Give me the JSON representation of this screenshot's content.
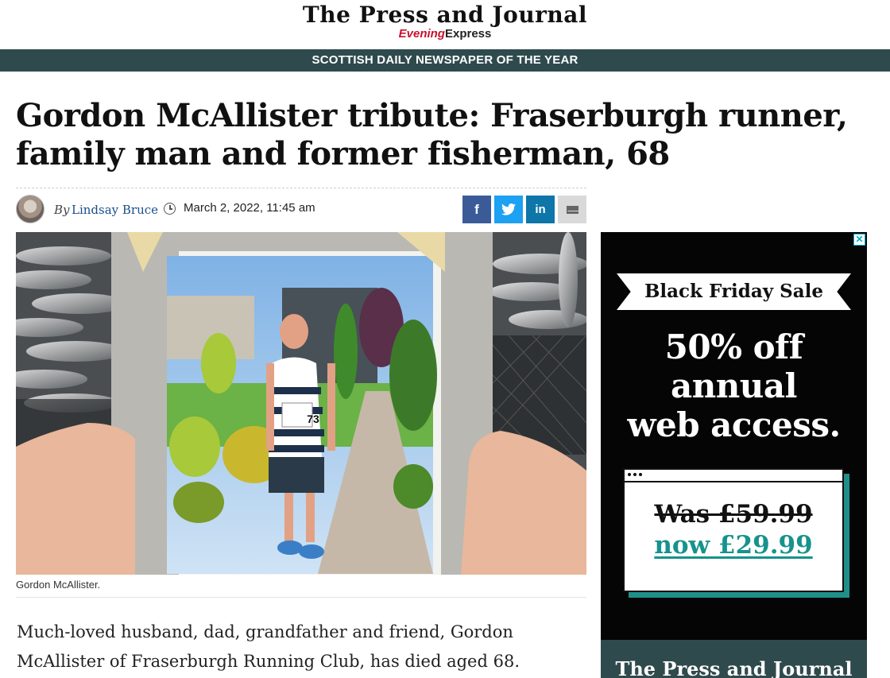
{
  "masthead": {
    "logo_main": "The Press and Journal",
    "logo_sub_red": "Evening",
    "logo_sub_dark": "Express",
    "tagline": "SCOTTISH DAILY NEWSPAPER OF THE YEAR"
  },
  "article": {
    "headline": "Gordon McAllister tribute: Fraserburgh runner, family man and former fisherman, 68",
    "byline_prefix": "By",
    "author": "Lindsay Bruce",
    "date": "March 2, 2022, 11:45 am",
    "share_buttons": [
      {
        "icon": "facebook-icon",
        "glyph": "f"
      },
      {
        "icon": "twitter-icon",
        "glyph": "t"
      },
      {
        "icon": "linkedin-icon",
        "glyph": "in"
      },
      {
        "icon": "email-icon",
        "glyph": ""
      }
    ],
    "image": {
      "runner_bib": "73",
      "caption": "Gordon McAllister."
    },
    "body_first_paragraph": "Much-loved husband, dad, grandfather and friend, Gordon McAllister of Fraserburgh Running Club, has died aged 68."
  },
  "ad": {
    "close_glyph": "✕",
    "ribbon": "Black Friday Sale",
    "offer_line1": "50% off",
    "offer_line2": "annual",
    "offer_line3": "web access.",
    "was_price": "Was £59.99",
    "now_price": "now £29.99",
    "footer_logo": "The Press and Journal"
  },
  "colors": {
    "nav_bar": "#2f4a4d",
    "author_link": "#1a4f8a",
    "facebook": "#3b5b98",
    "twitter": "#1da1f2",
    "linkedin": "#0e76a8",
    "ad_accent": "#17928c",
    "brand_red": "#c8102e"
  }
}
